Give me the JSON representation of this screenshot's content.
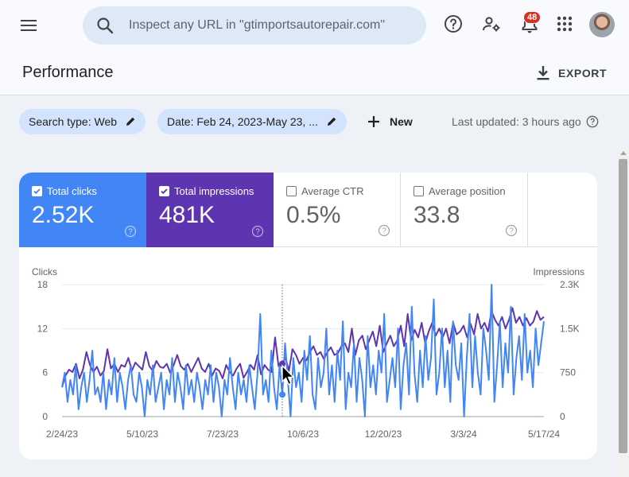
{
  "topbar": {
    "search_placeholder": "Inspect any URL in \"gtimportsautorepair.com\"",
    "notification_count": "48",
    "icons": [
      "menu-icon",
      "search-icon",
      "help-icon",
      "manage-users-icon",
      "notifications-icon",
      "apps-icon"
    ]
  },
  "header": {
    "title": "Performance",
    "export_label": "EXPORT"
  },
  "filters": {
    "search_type": "Search type: Web",
    "date_range": "Date: Feb 24, 2023-May 23, ...",
    "new_label": "New",
    "last_updated": "Last updated: 3 hours ago"
  },
  "metrics": [
    {
      "label": "Total clicks",
      "value": "2.52K",
      "checked": true,
      "color": "#4285f4"
    },
    {
      "label": "Total impressions",
      "value": "481K",
      "checked": true,
      "color": "#5e35b1"
    },
    {
      "label": "Average CTR",
      "value": "0.5%",
      "checked": false
    },
    {
      "label": "Average position",
      "value": "33.8",
      "checked": false
    }
  ],
  "chart_data": {
    "type": "line",
    "left_axis_label": "Clicks",
    "right_axis_label": "Impressions",
    "left_ticks": [
      "18",
      "12",
      "6",
      "0"
    ],
    "left_ylim": [
      0,
      18
    ],
    "right_ticks": [
      "2.3K",
      "1.5K",
      "750",
      "0"
    ],
    "right_ylim": [
      0,
      2250
    ],
    "x_ticks": [
      "2/24/23",
      "5/10/23",
      "7/23/23",
      "10/6/23",
      "12/20/23",
      "3/3/24",
      "5/17/24"
    ],
    "hover_date": "10/6/23",
    "series": [
      {
        "name": "Total clicks",
        "color": "#4285f4",
        "axis": "left",
        "values": [
          4,
          6,
          2,
          5,
          3,
          7,
          1,
          4,
          6,
          2,
          5,
          9,
          3,
          4,
          2,
          6,
          1,
          5,
          3,
          8,
          2,
          6,
          4,
          1,
          5,
          7,
          3,
          2,
          6,
          4,
          0,
          5,
          3,
          7,
          2,
          4,
          6,
          1,
          5,
          3,
          8,
          2,
          6,
          4,
          1,
          7,
          3,
          5,
          2,
          6,
          4,
          1,
          5,
          3,
          7,
          2,
          6,
          4,
          0,
          5,
          3,
          8,
          4,
          1,
          6,
          3,
          5,
          2,
          7,
          4,
          1,
          6,
          14,
          3,
          5,
          2,
          9,
          4,
          1,
          7,
          3,
          10,
          5,
          0,
          8,
          4,
          6,
          2,
          9,
          5,
          11,
          3,
          1,
          8,
          4,
          6,
          12,
          3,
          7,
          2,
          9,
          5,
          13,
          1,
          6,
          4,
          10,
          2,
          8,
          5,
          0,
          11,
          4,
          7,
          3,
          9,
          6,
          14,
          2,
          5,
          8,
          4,
          12,
          1,
          7,
          10,
          3,
          15,
          6,
          2,
          9,
          4,
          11,
          5,
          8,
          16,
          3,
          6,
          12,
          4,
          9,
          2,
          13,
          7,
          5,
          10,
          0,
          8,
          14,
          4,
          11,
          6,
          3,
          12,
          9,
          5,
          18,
          2,
          7,
          13,
          4,
          10,
          6,
          15,
          3,
          8,
          11,
          5,
          14,
          6,
          9,
          4,
          12,
          7,
          10,
          13
        ]
      },
      {
        "name": "Total impressions",
        "color": "#5e35b1",
        "axis": "right",
        "values": [
          500,
          700,
          800,
          760,
          900,
          650,
          800,
          1100,
          880,
          760,
          850,
          700,
          780,
          1150,
          820,
          900,
          760,
          880,
          850,
          1000,
          780,
          920,
          860,
          800,
          1100,
          860,
          780,
          950,
          850,
          830,
          900,
          750,
          880,
          1050,
          860,
          800,
          900,
          760,
          880,
          1000,
          820,
          760,
          900,
          700,
          820,
          780,
          650,
          880,
          760,
          700,
          820,
          900,
          660,
          760,
          880,
          800,
          1050,
          720,
          880,
          800,
          760,
          1350,
          860,
          900,
          1000,
          780,
          1150,
          1050,
          900,
          1000,
          960,
          1100,
          1200,
          1050,
          1100,
          980,
          1100,
          1180,
          1050,
          1080,
          1200,
          1250,
          1100,
          1500,
          1050,
          1300,
          1380,
          1150,
          1300,
          1450,
          1200,
          1550,
          1100,
          1250,
          1380,
          1200,
          1300,
          1550,
          1200,
          1750,
          1300,
          1480,
          1350,
          1600,
          1250,
          1450,
          1600,
          1380,
          1500,
          1350,
          1500,
          1250,
          1600,
          1400,
          1450,
          1550,
          1350,
          1580,
          1400,
          1750,
          1500,
          1600,
          1450,
          1800,
          1650,
          1550,
          1700,
          1500,
          1650,
          1850,
          1600,
          1700,
          1550,
          1680,
          1550,
          1620,
          1800,
          1650,
          1700
        ]
      }
    ]
  }
}
